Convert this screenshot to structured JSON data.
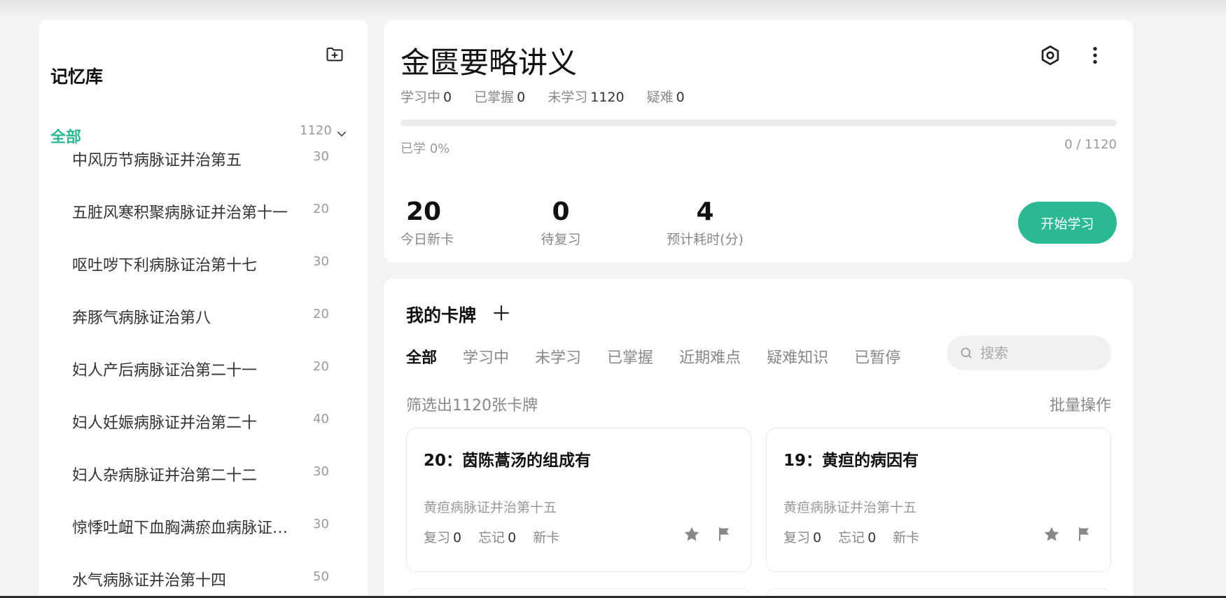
{
  "sidebar": {
    "title": "记忆库",
    "all": {
      "label": "全部",
      "count": "1120"
    },
    "items": [
      {
        "label": "中风历节病脉证并治第五",
        "count": "30"
      },
      {
        "label": "五脏风寒积聚病脉证并治第十一",
        "count": "20"
      },
      {
        "label": "呕吐哕下利病脉证治第十七",
        "count": "30"
      },
      {
        "label": "奔豚气病脉证治第八",
        "count": "20"
      },
      {
        "label": "妇人产后病脉证治第二十一",
        "count": "20"
      },
      {
        "label": "妇人妊娠病脉证并治第二十",
        "count": "40"
      },
      {
        "label": "妇人杂病脉证并治第二十二",
        "count": "30"
      },
      {
        "label": "惊悸吐衄下血胸满瘀血病脉证…",
        "count": "30"
      },
      {
        "label": "水气病脉证并治第十四",
        "count": "50"
      }
    ]
  },
  "deck": {
    "title": "金匮要略讲义",
    "stats": [
      {
        "label": "学习中",
        "value": "0"
      },
      {
        "label": "已掌握",
        "value": "0"
      },
      {
        "label": "未学习",
        "value": "1120"
      },
      {
        "label": "疑难",
        "value": "0"
      }
    ],
    "progress": 0,
    "learned_text": "已学 0%",
    "learned_count": "0 / 1120",
    "metrics": [
      {
        "value": "20",
        "label": "今日新卡"
      },
      {
        "value": "0",
        "label": "待复习"
      },
      {
        "value": "4",
        "label": "预计耗时(分)"
      }
    ],
    "start_label": "开始学习"
  },
  "cards_panel": {
    "title": "我的卡牌",
    "tabs": [
      "全部",
      "学习中",
      "未学习",
      "已掌握",
      "近期难点",
      "疑难知识",
      "已暂停"
    ],
    "search_placeholder": "搜索",
    "filter_text": "筛选出1120张卡牌",
    "batch_label": "批量操作",
    "cards": [
      {
        "title": "20：茵陈蒿汤的组成有",
        "chapter": "黄疸病脉证并治第十五",
        "review_label": "复习",
        "review": "0",
        "forget_label": "忘记",
        "forget": "0",
        "status": "新卡"
      },
      {
        "title": "19：黄疸的病因有",
        "chapter": "黄疸病脉证并治第十五",
        "review_label": "复习",
        "review": "0",
        "forget_label": "忘记",
        "forget": "0",
        "status": "新卡"
      }
    ]
  },
  "colors": {
    "accent": "#2bb895",
    "icon": "#888888"
  },
  "icons": [
    "folder-add-icon",
    "chevron-down-icon",
    "settings-icon",
    "more-vertical-icon",
    "plus-icon",
    "search-icon",
    "star-icon",
    "flag-icon"
  ]
}
